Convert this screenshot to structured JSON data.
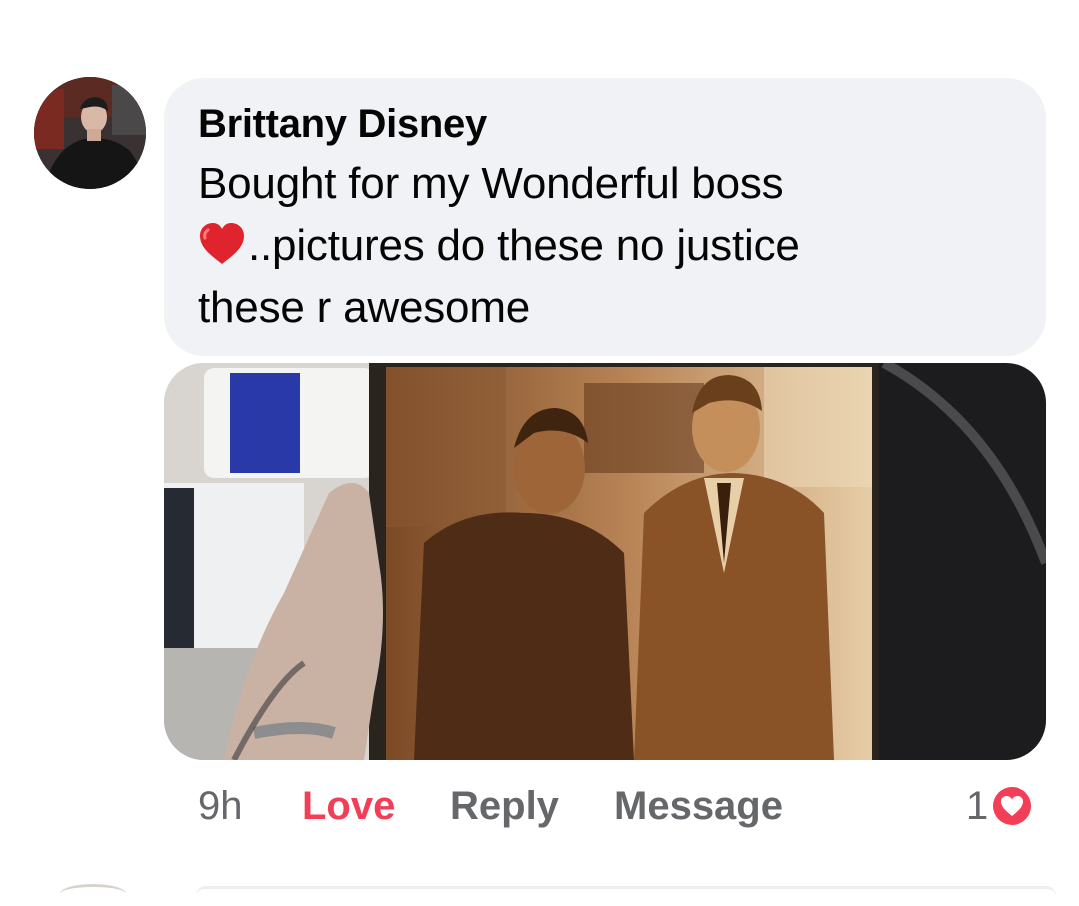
{
  "comment": {
    "author": "Brittany Disney",
    "text_line1": "Bought for my Wonderful boss",
    "text_line2": "..pictures do these no justice",
    "text_line3": "these r awesome",
    "inline_emoji": "red-heart-icon"
  },
  "actions": {
    "time": "9h",
    "love_label": "Love",
    "reply_label": "Reply",
    "message_label": "Message"
  },
  "reactions": {
    "count": "1",
    "icon": "love-reaction-icon"
  },
  "colors": {
    "bubble_bg": "#f0f2f5",
    "love_active": "#f33e58",
    "muted_text": "#65676b",
    "text": "#050505"
  }
}
